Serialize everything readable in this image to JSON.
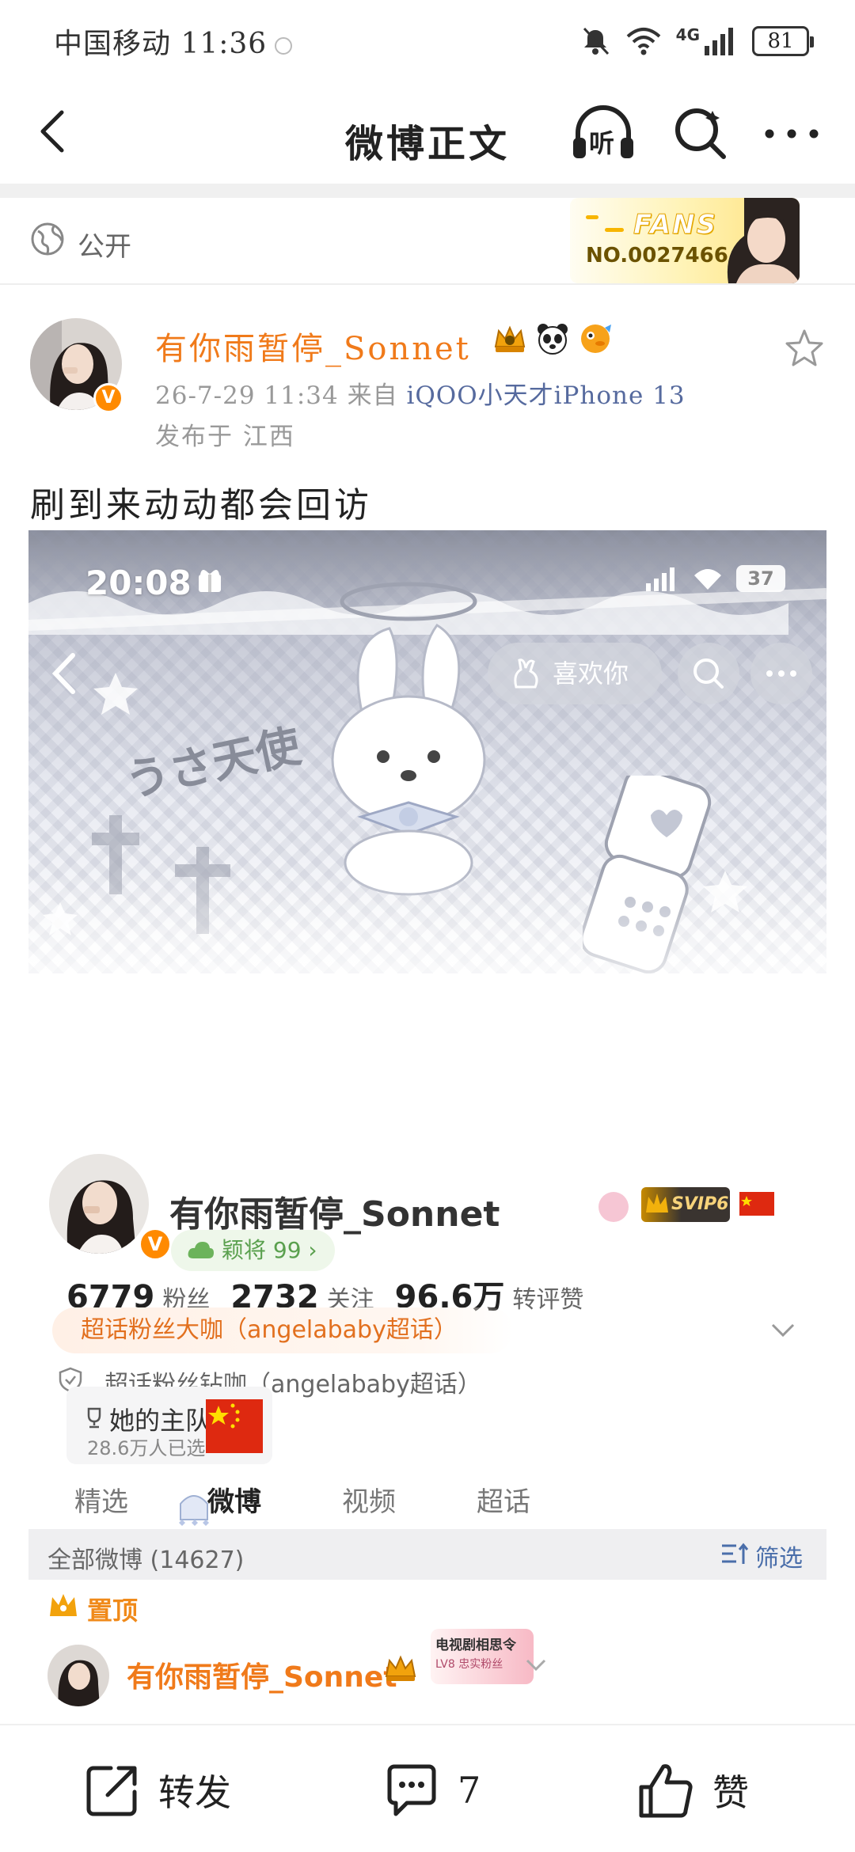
{
  "status_bar": {
    "carrier_time": "中国移动 11:36",
    "network": "4G",
    "battery": "81"
  },
  "nav": {
    "title": "微博正文",
    "listen_label": "听"
  },
  "visibility": {
    "label": "公开"
  },
  "fans_card": {
    "title": "FANS",
    "number": "NO.0027466"
  },
  "post": {
    "author": "有你雨暂停_Sonnet",
    "meta_prefix": "26-7-29 11:34 来自 ",
    "source": "iQOO",
    "source_suffix": "小天才iPhone 13",
    "location": "发布于 江西",
    "text": "刷到来动动都会回访"
  },
  "screenshot": {
    "time": "20:08",
    "battery": "37",
    "like_pill": "喜欢你",
    "art_text": "うさ天使",
    "profile_name": "有你雨暂停_Sonnet",
    "svip": "SVIP6",
    "fan_level": "颖将 99",
    "stats": [
      {
        "num": "6779",
        "label": "粉丝"
      },
      {
        "num": "2732",
        "label": "关注"
      },
      {
        "num": "96.6万",
        "label": "转评赞"
      }
    ],
    "supertopic_tag": "超话粉丝大咖（angelababy超话）",
    "supertopic_tag2": "超话粉丝钻咖（angelababy超话）",
    "team_title": "她的主队",
    "team_count": "28.6万人已选",
    "tabs": [
      "精选",
      "微博",
      "视频",
      "超话"
    ],
    "active_tab": "微博",
    "list_title": "全部微博 (14627)",
    "filter_label": "筛选",
    "pinned_label": "置顶",
    "inner_author": "有你雨暂停_Sonnet",
    "tv_badge_line1": "电视剧相思令",
    "tv_badge_line2": "LV8 忠实粉丝"
  },
  "actions": {
    "repost": "转发",
    "comment_count": "7",
    "like": "赞"
  },
  "colors": {
    "accent_orange": "#f07a1a",
    "link_blue": "#566a9e",
    "fan_green": "#5aa04e"
  }
}
